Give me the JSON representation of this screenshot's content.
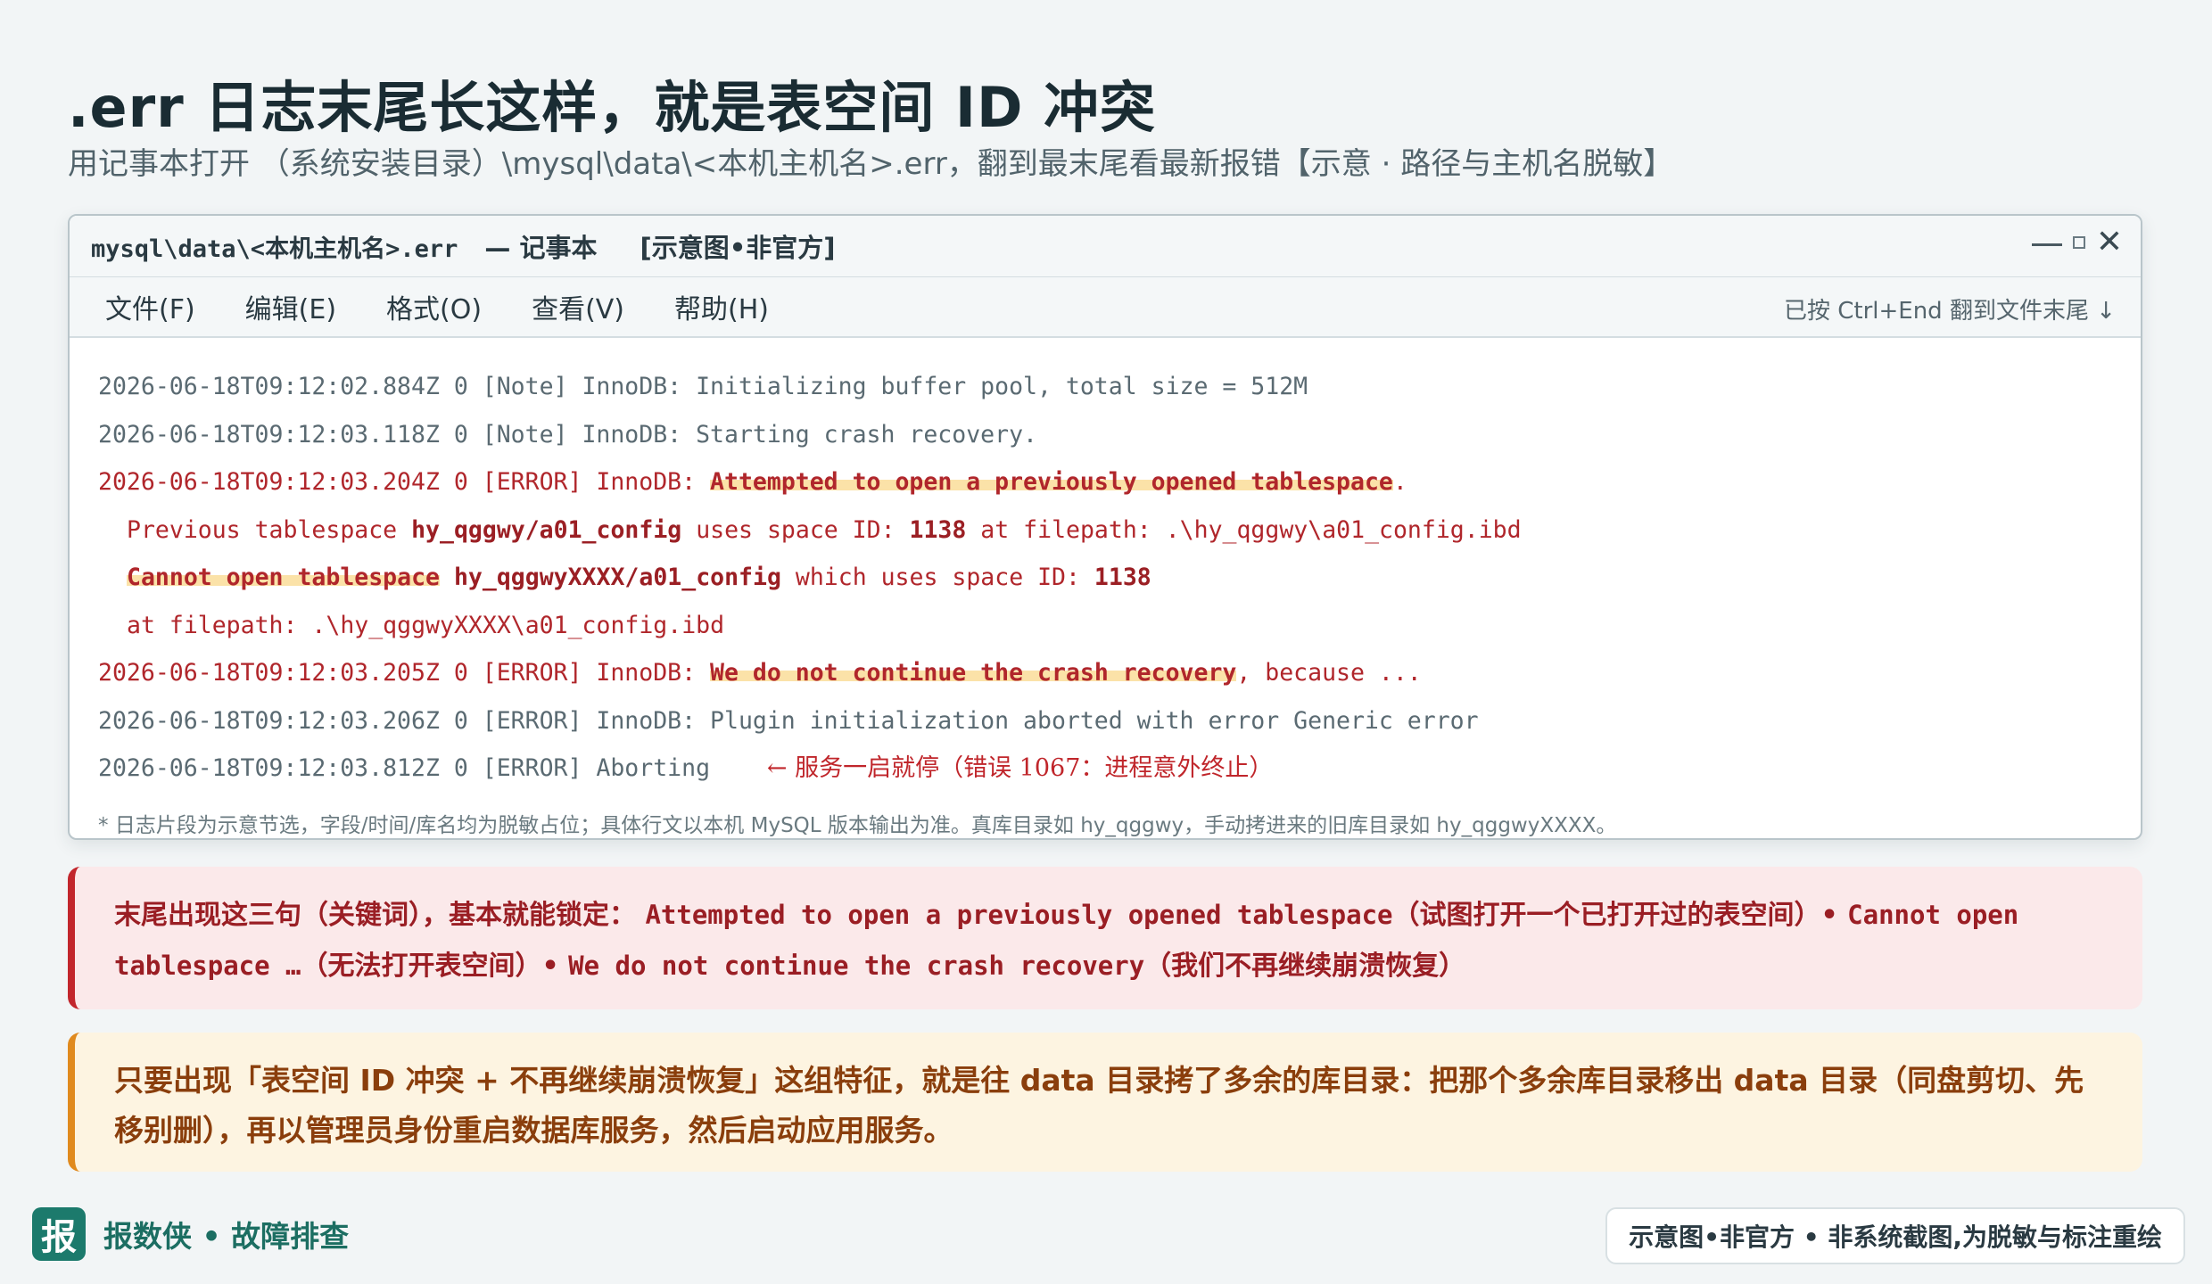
{
  "page": {
    "title": ".err 日志末尾长这样，就是表空间 ID 冲突",
    "subtitle": "用记事本打开 （系统安装目录）\\mysql\\data\\<本机主机名>.err，翻到最末尾看最新报错【示意 · 路径与主机名脱敏】"
  },
  "window": {
    "filename": "mysql\\data\\<本机主机名>.err",
    "app": "— 记事本",
    "tag": "[示意图•非官方]",
    "menu": [
      "文件(F)",
      "编辑(E)",
      "格式(O)",
      "查看(V)",
      "帮助(H)"
    ],
    "menu_hint": "已按 Ctrl+End 翻到文件末尾 ↓",
    "log": {
      "l1": "2026-06-18T09:12:02.884Z 0 [Note] InnoDB: Initializing buffer pool, total size = 512M",
      "l2": "2026-06-18T09:12:03.118Z 0 [Note] InnoDB: Starting crash recovery.",
      "l3_pre": "2026-06-18T09:12:03.204Z 0 [ERROR] InnoDB: ",
      "l3_hl": "Attempted to open a previously opened tablespace",
      "l3_post": ".",
      "l4_a": "Previous tablespace ",
      "l4_b": "hy_qggwy/a01_config",
      "l4_c": " uses space ID: ",
      "l4_d": "1138",
      "l4_e": " at filepath: .\\hy_qggwy\\a01_config.ibd",
      "l5_hl": "Cannot open tablespace",
      "l5_b": "hy_qggwyXXXX/a01_config",
      "l5_c": " which uses space ID: ",
      "l5_d": "1138",
      "l6": "at filepath: .\\hy_qggwyXXXX\\a01_config.ibd",
      "l7_pre": "2026-06-18T09:12:03.205Z 0 [ERROR] InnoDB: ",
      "l7_hl": "We do not continue the crash recovery",
      "l7_post": ", because ...",
      "l8": "2026-06-18T09:12:03.206Z 0 [ERROR] InnoDB: Plugin initialization aborted with error Generic error",
      "l9": "2026-06-18T09:12:03.812Z 0 [ERROR] Aborting",
      "l9_note": "← 服务一启就停（错误 1067：进程意外终止）"
    },
    "footnote": "* 日志片段为示意节选，字段/时间/库名均为脱敏占位；具体行文以本机 MySQL 版本输出为准。真库目录如 hy_qggwy，手动拷进来的旧库目录如 hy_qggwyXXXX。"
  },
  "callout_keywords": {
    "lead": "末尾出现这三句（关键词），基本就能锁定：",
    "k1": "Attempted to open a previously opened tablespace",
    "k1_cn": "（试图打开一个已打开过的表空间）•",
    "k2": "Cannot open tablespace …",
    "k2_cn": "（无法打开表空间）•",
    "k3": "We do not continue the crash recovery",
    "k3_cn": "（我们不再继续崩溃恢复）"
  },
  "callout_fix": {
    "text": "只要出现「表空间 ID 冲突 + 不再继续崩溃恢复」这组特征，就是往 data 目录拷了多余的库目录：把那个多余库目录移出 data 目录（同盘剪切、先移别删），再以管理员身份重启数据库服务，然后启动应用服务。"
  },
  "footer": {
    "logo_char": "报",
    "brand": "报数侠 • 故障排查",
    "disclaimer": "示意图•非官方 • 非系统截图,为脱敏与标注重绘"
  },
  "colors": {
    "accent_green": "#1c7a6c",
    "error_red": "#b0262b",
    "warn_orange": "#e08a1e",
    "highlight": "#fbe2a8"
  }
}
